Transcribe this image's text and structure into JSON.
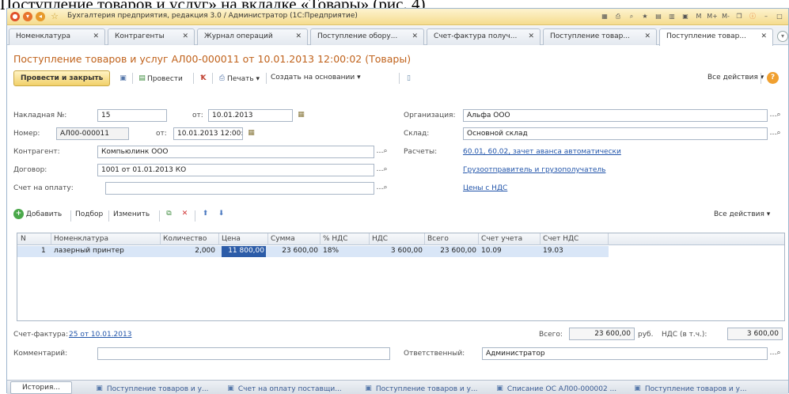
{
  "caption": "Поступление товаров и услуг» на вкладке «Товары» (рис. 4)",
  "window": {
    "title": "Бухгалтерия предприятия, редакция 3.0 / Администратор  (1С:Предприятие)",
    "right_tools": [
      "M",
      "M+",
      "M-"
    ]
  },
  "tabs": [
    {
      "label": "Номенклатура"
    },
    {
      "label": "Контрагенты"
    },
    {
      "label": "Журнал операций"
    },
    {
      "label": "Поступление обору..."
    },
    {
      "label": "Счет-фактура получ..."
    },
    {
      "label": "Поступление товар..."
    },
    {
      "label": "Поступление товар..."
    }
  ],
  "doc_title": "Поступление товаров и услуг АЛ00-000011 от 10.01.2013 12:00:02 (Товары)",
  "toolbar": {
    "post_close": "Провести и закрыть",
    "post": "Провести",
    "print": "Печать",
    "create_based": "Создать на основании",
    "all_actions": "Все действия"
  },
  "form": {
    "invoice_no_label": "Накладная №:",
    "invoice_no": "15",
    "from_label": "от:",
    "invoice_date": "10.01.2013",
    "number_label": "Номер:",
    "number": "АЛ00-000011",
    "from_label2": "от:",
    "number_date": "10.01.2013 12:00:02",
    "counterparty_label": "Контрагент:",
    "counterparty": "Компьюлинк ООО",
    "contract_label": "Договор:",
    "contract": "1001 от 01.01.2013 КО",
    "payment_invoice_label": "Счет на оплату:",
    "payment_invoice": "",
    "org_label": "Организация:",
    "org": "Альфа ООО",
    "warehouse_label": "Склад:",
    "warehouse": "Основной склад",
    "settlements_label": "Расчеты:",
    "settlements_link": "60.01, 60.02, зачет аванса автоматически",
    "shipper_link": "Грузоотправитель и грузополучатель",
    "prices_link": "Цены с НДС"
  },
  "grid_toolbar": {
    "add": "Добавить",
    "select": "Подбор",
    "change": "Изменить",
    "all_actions": "Все действия"
  },
  "grid": {
    "headers": [
      "N",
      "Номенклатура",
      "Количество",
      "Цена",
      "Сумма",
      "% НДС",
      "НДС",
      "Всего",
      "Счет учета",
      "Счет НДС"
    ],
    "rows": [
      {
        "n": "1",
        "item": "лазерный принтер",
        "qty": "2,000",
        "price": "11 800,00",
        "sum": "23 600,00",
        "vat_rate": "18%",
        "vat": "3 600,00",
        "total": "23 600,00",
        "account": "10.09",
        "vat_account": "19.03"
      }
    ]
  },
  "footer": {
    "invoice_label": "Счет-фактура:",
    "invoice_link": "25 от 10.01.2013",
    "total_label": "Всего:",
    "total": "23 600,00",
    "currency": "руб.",
    "vat_label": "НДС (в т.ч.):",
    "vat": "3 600,00",
    "comment_label": "Комментарий:",
    "comment": "",
    "responsible_label": "Ответственный:",
    "responsible": "Администратор"
  },
  "taskbar": {
    "history": "История...",
    "items": [
      "Поступление товаров и у...",
      "Счет на оплату поставщи...",
      "Поступление товаров и у...",
      "Списание ОС АЛ00-000002 ...",
      "Поступление товаров и у..."
    ]
  },
  "colors": {
    "accent": "#c0621b",
    "link": "#2255aa",
    "selection": "#2c5ca8"
  }
}
